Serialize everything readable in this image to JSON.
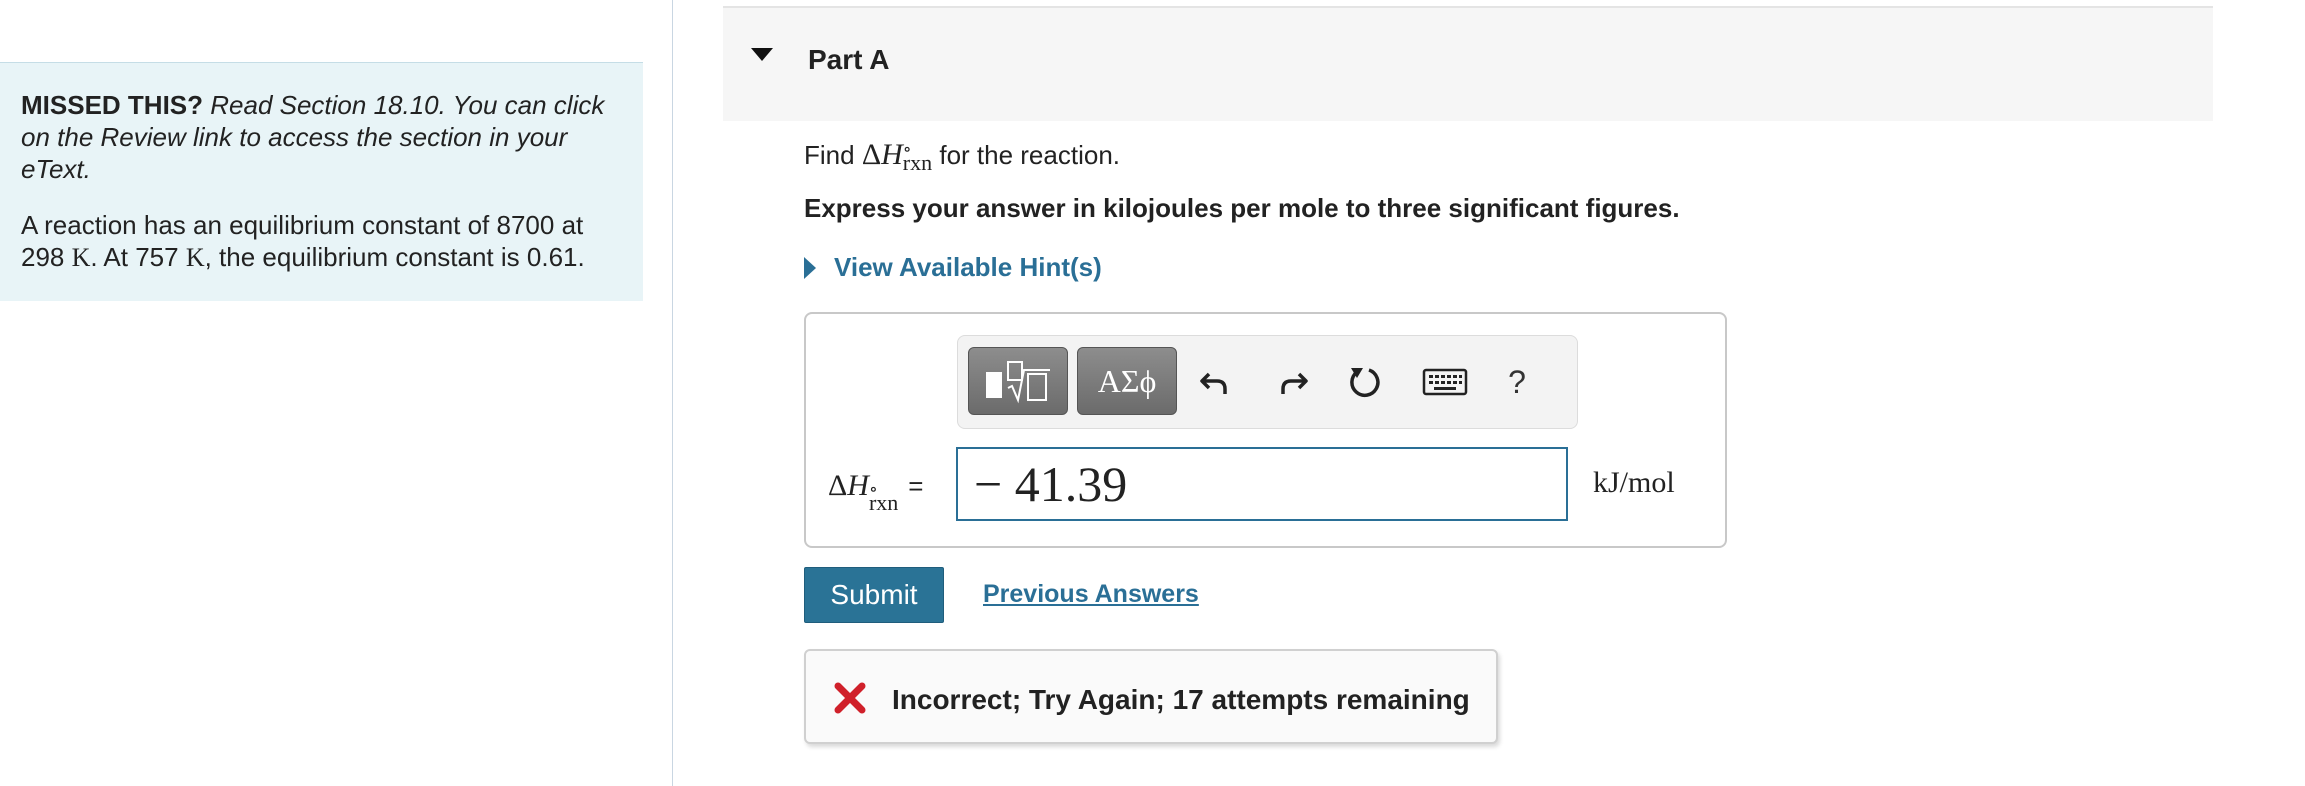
{
  "left_panel": {
    "missed_label": "MISSED THIS?",
    "missed_text": "Read Section 18.10. You can click on the Review link to access the section in your eText.",
    "reaction_pre": "A reaction has an equilibrium constant of 8700 at 298",
    "reaction_unit1": "K",
    "reaction_mid": ". At 757",
    "reaction_unit2": "K",
    "reaction_post": ", the equilibrium constant is 0.61."
  },
  "part": {
    "title": "Part A"
  },
  "question": {
    "prompt_pre": "Find",
    "delta": "Δ",
    "H": "H",
    "superscript": "∘",
    "subscript": "rxn",
    "prompt_post": "for the reaction.",
    "instruction": "Express your answer in kilojoules per mole to three significant figures.",
    "hint_label": "View Available Hint(s)"
  },
  "toolbar": {
    "symbols_label": "ΑΣϕ",
    "help_label": "?",
    "icons": [
      "templates-icon",
      "undo-icon",
      "redo-icon",
      "reset-icon",
      "keyboard-icon",
      "help-icon"
    ]
  },
  "answer": {
    "label_delta": "Δ",
    "label_H": "H",
    "label_sup": "∘",
    "label_sub": "rxn",
    "equals": "=",
    "value": "− 41.39",
    "unit": "kJ/mol"
  },
  "actions": {
    "submit_label": "Submit",
    "previous_answers_label": "Previous Answers"
  },
  "feedback": {
    "text": "Incorrect; Try Again; 17 attempts remaining",
    "status_color": "#d0202a"
  },
  "colors": {
    "accent": "#2a6f96",
    "info_bg": "#e8f4f7"
  }
}
